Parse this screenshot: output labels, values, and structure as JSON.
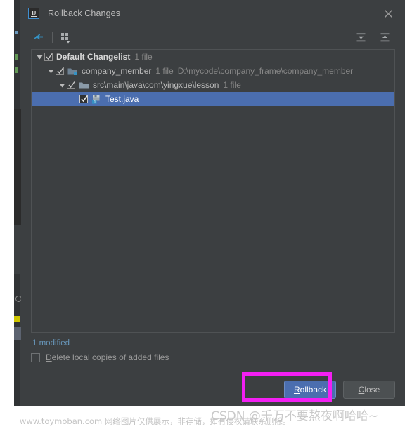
{
  "dialog": {
    "title": "Rollback Changes",
    "app_icon": "intellij-idea-icon",
    "close_icon": "close-icon"
  },
  "toolbar": {
    "rollback_icon": "rollback-arrow-icon",
    "group_by_icon": "group-by-icon",
    "group_by_dropdown_icon": "chevron-down-icon",
    "expand_all_icon": "expand-all-icon",
    "collapse_all_icon": "collapse-all-icon"
  },
  "tree": {
    "rows": [
      {
        "label": "Default Changelist",
        "meta": "1 file",
        "path": "",
        "checked": true,
        "expanded": true,
        "selected": false,
        "icon": "",
        "depth": 1
      },
      {
        "label": "company_member",
        "meta": "1 file",
        "path": "D:\\mycode\\company_frame\\company_member",
        "checked": true,
        "expanded": true,
        "selected": false,
        "icon": "module-folder-icon",
        "depth": 2
      },
      {
        "label": "src\\main\\java\\com\\yingxue\\lesson",
        "meta": "1 file",
        "path": "",
        "checked": true,
        "expanded": true,
        "selected": false,
        "icon": "folder-icon",
        "depth": 3
      },
      {
        "label": "Test.java",
        "meta": "",
        "path": "",
        "checked": true,
        "expanded": false,
        "selected": true,
        "icon": "java-class-icon",
        "depth": 4
      }
    ]
  },
  "status": {
    "text": "1 modified",
    "color": "#6897bb"
  },
  "options": {
    "delete_local_copies": {
      "mnemonic": "D",
      "rest": "elete local copies of added files",
      "checked": false
    }
  },
  "buttons": {
    "rollback": {
      "mnemonic": "R",
      "rest": "ollback"
    },
    "close": {
      "mnemonic": "C",
      "rest": "lose"
    }
  },
  "annotation": {
    "color": "#f31ff3",
    "target": "rollback-button"
  },
  "watermarks": {
    "csdn": "CSDN @千万不要熬夜啊哈哈~",
    "footer": "www.toymoban.com 网络图片仅供展示，非存储，如有侵权请联系删除。"
  }
}
